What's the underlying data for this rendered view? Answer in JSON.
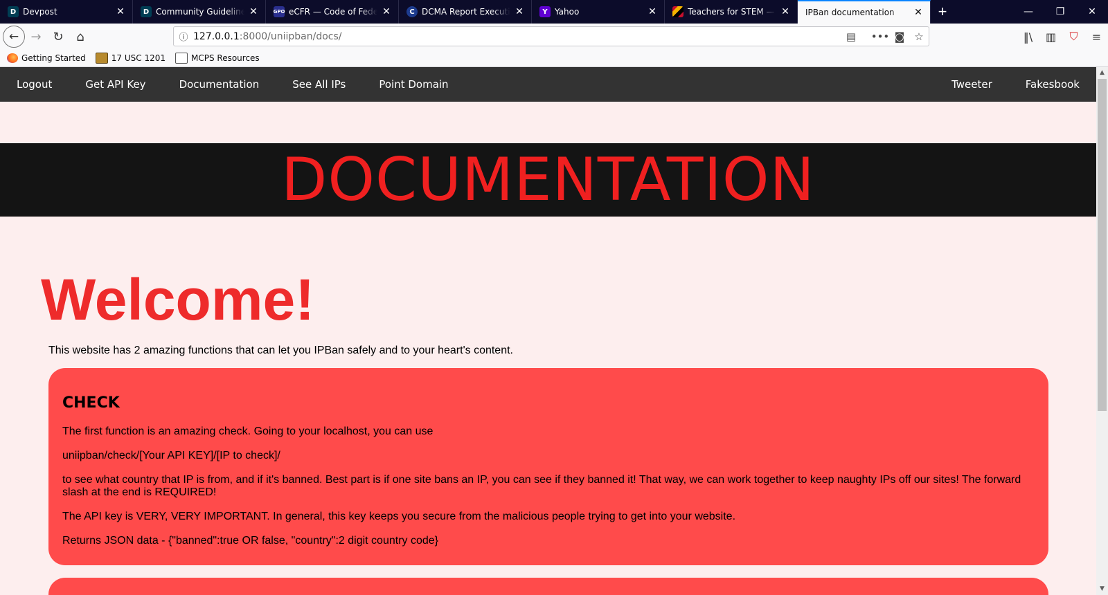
{
  "tabs": [
    {
      "title": "Devpost",
      "icon": "devpost-icon",
      "glyph": "D",
      "color": "#003e54",
      "active": false
    },
    {
      "title": "Community Guidelines",
      "icon": "devpost-icon",
      "glyph": "D",
      "color": "#003e54",
      "active": false
    },
    {
      "title": "eCFR — Code of Federal Regulations",
      "icon": "gpo-icon",
      "glyph": "GPO",
      "color": "#2a2f8f",
      "active": false
    },
    {
      "title": "DCMA Report Executive Summary",
      "icon": "copyright-icon",
      "glyph": "C",
      "color": "#1d3c8f",
      "active": false
    },
    {
      "title": "Yahoo",
      "icon": "yahoo-icon",
      "glyph": "Y",
      "color": "#6001d2",
      "active": false
    },
    {
      "title": "Teachers for STEM — Welcome",
      "icon": "maryland-flag-icon",
      "glyph": "",
      "color": "#c8102e",
      "active": false
    },
    {
      "title": "IPBan documentation",
      "icon": "",
      "glyph": "",
      "color": "",
      "active": true
    }
  ],
  "window_controls": {
    "minimize": "—",
    "restore": "❐",
    "close": "✕"
  },
  "url": {
    "host": "127.0.0.1",
    "rest": ":8000/uniipban/docs/"
  },
  "bookmarks": [
    {
      "label": "Getting Started",
      "icon": "firefox-icon"
    },
    {
      "label": "17 USC 1201",
      "icon": "seal-icon"
    },
    {
      "label": "MCPS Resources",
      "icon": "folder-icon"
    }
  ],
  "site_nav": {
    "left": [
      "Logout",
      "Get API Key",
      "Documentation",
      "See All IPs",
      "Point Domain"
    ],
    "right": [
      "Tweeter",
      "Fakesbook"
    ]
  },
  "banner": "DOCUMENTATION",
  "welcome": "Welcome!",
  "intro": "This website has 2 amazing functions that can let you IPBan safely and to your heart's content.",
  "check_section": {
    "heading": "CHECK",
    "paragraphs": [
      "The first function is an amazing check. Going to your localhost, you can use",
      "uniipban/check/[Your API KEY]/[IP to check]/",
      "to see what country that IP is from, and if it's banned. Best part is if one site bans an IP, you can see if they banned it! That way, we can work together to keep naughty IPs off our sites! The forward slash at the end is REQUIRED!",
      "The API key is VERY, VERY IMPORTANT. In general, this key keeps you secure from the malicious people trying to get into your website.",
      "Returns JSON data - {\"banned\":true OR false, \"country\":2 digit country code}"
    ]
  },
  "colors": {
    "accent": "#ee2b2b",
    "card": "#ff4b4b",
    "nav": "#333333",
    "tab_active_line": "#0a84ff"
  }
}
